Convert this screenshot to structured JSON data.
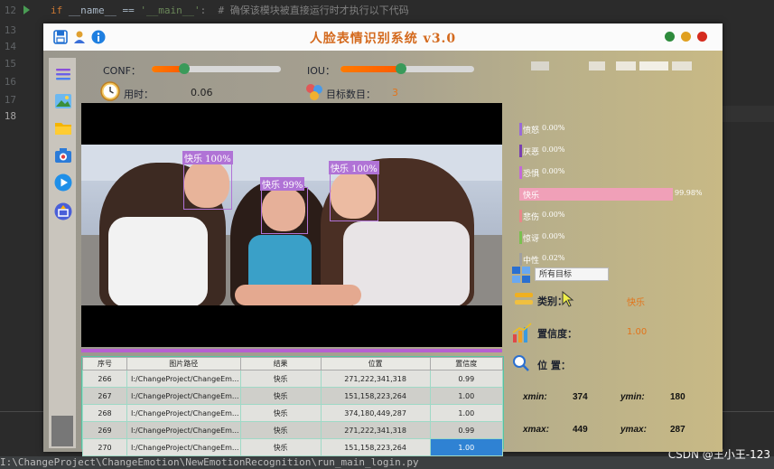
{
  "ide": {
    "lines": [
      {
        "num": "12",
        "code_kw": "if",
        "code_rest": " __name__ == ",
        "code_str": "'__main__'",
        "code_cmt": ":  # 确保该模块被直接运行时才执行以下代码"
      },
      {
        "num": "13"
      },
      {
        "num": "14"
      },
      {
        "num": "15"
      },
      {
        "num": "16"
      },
      {
        "num": "17"
      },
      {
        "num": "18"
      }
    ],
    "status_path": "I:\\ChangeProject\\ChangeEmotion\\NewEmotionRecognition\\run_main_login.py",
    "watermark": "CSDN @王小王-123"
  },
  "window": {
    "title": "人脸表情识别系统  v3.0",
    "icons": [
      "save-icon",
      "user-icon",
      "info-icon"
    ],
    "dots": [
      "#2e8b3c",
      "#e0a020",
      "#d52b1e"
    ]
  },
  "sidebar": {
    "icons": [
      "menu-icon",
      "image-icon",
      "folder-icon",
      "camera-icon",
      "play-icon",
      "export-icon"
    ]
  },
  "controls": {
    "conf_label": "CONF：",
    "conf_value": 0.25,
    "iou_label": "IOU：",
    "iou_value": 0.45,
    "time_label": "用时：",
    "time_value": "0.06",
    "count_label": "目标数目：",
    "count_value": "3"
  },
  "detections": [
    {
      "label": "快乐  100%"
    },
    {
      "label": "快乐  99%"
    },
    {
      "label": "快乐  100%"
    }
  ],
  "table": {
    "headers": [
      "序号",
      "图片路径",
      "结果",
      "位置",
      "置信度"
    ],
    "rows": [
      {
        "id": "266",
        "path": "I:/ChangeProject/ChangeEm...",
        "result": "快乐",
        "pos": "271,222,341,318",
        "conf": "0.99"
      },
      {
        "id": "267",
        "path": "I:/ChangeProject/ChangeEm...",
        "result": "快乐",
        "pos": "151,158,223,264",
        "conf": "1.00"
      },
      {
        "id": "268",
        "path": "I:/ChangeProject/ChangeEm...",
        "result": "快乐",
        "pos": "374,180,449,287",
        "conf": "1.00"
      },
      {
        "id": "269",
        "path": "I:/ChangeProject/ChangeEm...",
        "result": "快乐",
        "pos": "271,222,341,318",
        "conf": "0.99"
      },
      {
        "id": "270",
        "path": "I:/ChangeProject/ChangeEm...",
        "result": "快乐",
        "pos": "151,158,223,264",
        "conf": "1.00"
      }
    ]
  },
  "emotions": [
    {
      "name": "愤怒",
      "value": "0.00%",
      "frac": 0.0,
      "color": "#9a6ad8"
    },
    {
      "name": "厌恶",
      "value": "0.00%",
      "frac": 0.0,
      "color": "#7a3fb0"
    },
    {
      "name": "恐惧",
      "value": "0.00%",
      "frac": 0.0,
      "color": "#c36ad8"
    },
    {
      "name": "快乐",
      "value": "99.98%",
      "frac": 0.9998,
      "color": "#f0a0b8"
    },
    {
      "name": "悲伤",
      "value": "0.00%",
      "frac": 0.0,
      "color": "#e8888a"
    },
    {
      "name": "惊讶",
      "value": "0.00%",
      "frac": 0.0,
      "color": "#7ac050"
    },
    {
      "name": "中性",
      "value": "0.02%",
      "frac": 0.0002,
      "color": "#a0a0a0"
    }
  ],
  "details": {
    "target_select": "所有目标",
    "class_label": "类别：",
    "class_value": "快乐",
    "conf_label": "置信度：",
    "conf_value": "1.00",
    "pos_label": "位  置：",
    "xmin_label": "xmin:",
    "xmin": "374",
    "ymin_label": "ymin:",
    "ymin": "180",
    "xmax_label": "xmax:",
    "xmax": "449",
    "ymax_label": "ymax:",
    "ymax": "287"
  }
}
